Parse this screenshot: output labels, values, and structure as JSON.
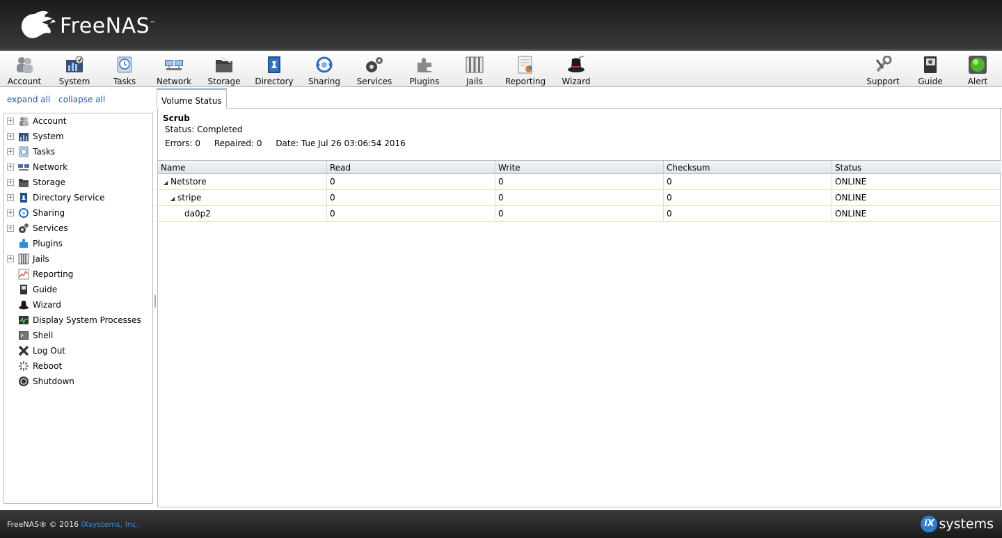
{
  "brand": {
    "name": "FreeNAS",
    "tm": "™"
  },
  "toolbar": {
    "left": [
      {
        "label": "Account",
        "icon": "account-icon"
      },
      {
        "label": "System",
        "icon": "system-icon"
      },
      {
        "label": "Tasks",
        "icon": "tasks-icon"
      },
      {
        "label": "Network",
        "icon": "network-icon"
      },
      {
        "label": "Storage",
        "icon": "storage-icon"
      },
      {
        "label": "Directory",
        "icon": "directory-icon"
      },
      {
        "label": "Sharing",
        "icon": "sharing-icon"
      },
      {
        "label": "Services",
        "icon": "services-icon"
      },
      {
        "label": "Plugins",
        "icon": "plugins-icon"
      },
      {
        "label": "Jails",
        "icon": "jails-icon"
      },
      {
        "label": "Reporting",
        "icon": "reporting-icon"
      },
      {
        "label": "Wizard",
        "icon": "wizard-icon"
      }
    ],
    "right": [
      {
        "label": "Support",
        "icon": "support-icon"
      },
      {
        "label": "Guide",
        "icon": "guide-icon"
      },
      {
        "label": "Alert",
        "icon": "alert-icon"
      }
    ]
  },
  "sidebar": {
    "expand_all": "expand all",
    "collapse_all": "collapse all",
    "items": [
      {
        "label": "Account",
        "expandable": true
      },
      {
        "label": "System",
        "expandable": true
      },
      {
        "label": "Tasks",
        "expandable": true
      },
      {
        "label": "Network",
        "expandable": true
      },
      {
        "label": "Storage",
        "expandable": true
      },
      {
        "label": "Directory Service",
        "expandable": true
      },
      {
        "label": "Sharing",
        "expandable": true
      },
      {
        "label": "Services",
        "expandable": true
      },
      {
        "label": "Plugins",
        "expandable": false
      },
      {
        "label": "Jails",
        "expandable": true
      },
      {
        "label": "Reporting",
        "expandable": false
      },
      {
        "label": "Guide",
        "expandable": false
      },
      {
        "label": "Wizard",
        "expandable": false
      },
      {
        "label": "Display System Processes",
        "expandable": false
      },
      {
        "label": "Shell",
        "expandable": false
      },
      {
        "label": "Log Out",
        "expandable": false
      },
      {
        "label": "Reboot",
        "expandable": false
      },
      {
        "label": "Shutdown",
        "expandable": false
      }
    ]
  },
  "tab": {
    "label": "Volume Status"
  },
  "scrub": {
    "title": "Scrub",
    "status": "Status: Completed",
    "errors": "Errors: 0",
    "repaired": "Repaired: 0",
    "date": "Date: Tue Jul 26 03:06:54 2016"
  },
  "grid": {
    "columns": [
      "Name",
      "Read",
      "Write",
      "Checksum",
      "Status"
    ],
    "rows": [
      {
        "name": "Netstore",
        "read": "0",
        "write": "0",
        "checksum": "0",
        "status": "ONLINE"
      },
      {
        "name": "stripe",
        "read": "0",
        "write": "0",
        "checksum": "0",
        "status": "ONLINE"
      },
      {
        "name": "da0p2",
        "read": "0",
        "write": "0",
        "checksum": "0",
        "status": "ONLINE"
      }
    ]
  },
  "footer": {
    "copyright": "FreeNAS® © 2016 ",
    "company": "iXsystems, Inc.",
    "ix_badge": "iX",
    "ix_word": "systems"
  },
  "colors": {
    "header_bg": "#2a2a2a",
    "link": "#1f5aa6",
    "accent_blue": "#2a7fd0",
    "row_border": "#ecdcbf"
  }
}
